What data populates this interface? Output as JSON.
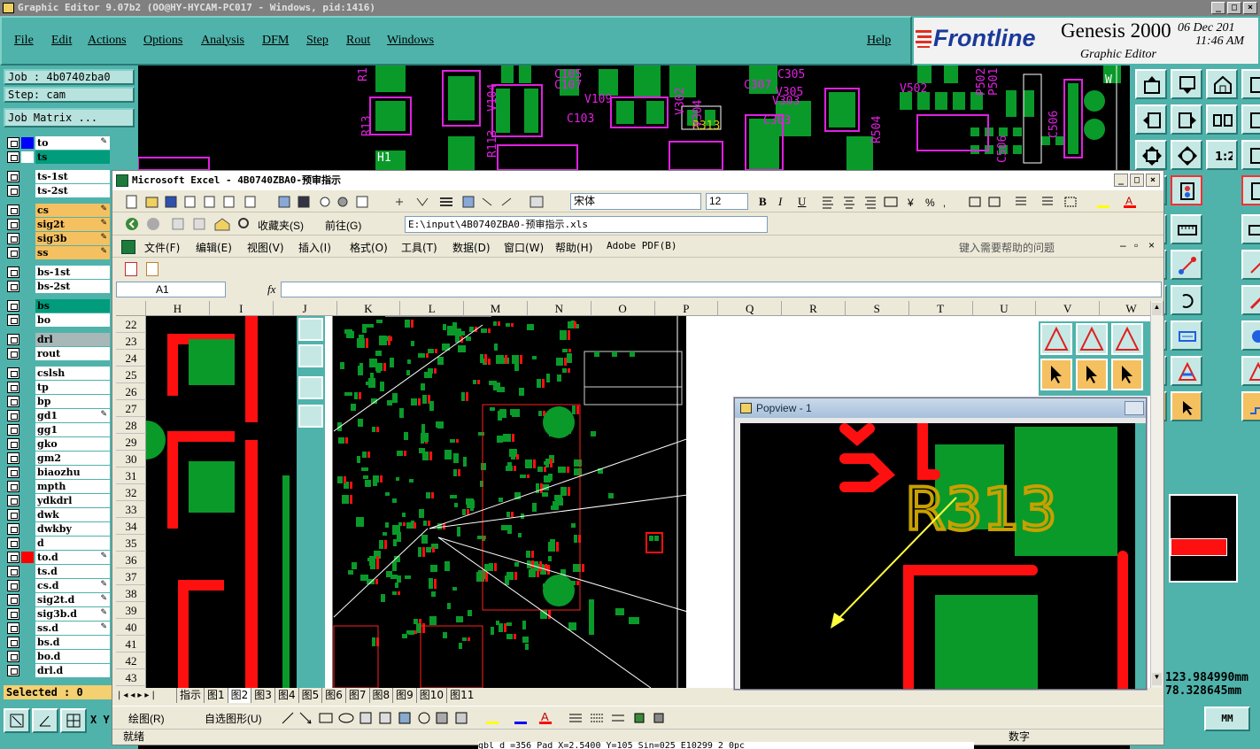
{
  "genesis": {
    "title": "Graphic Editor 9.07b2 (OO@HY-HYCAM-PC017 - Windows, pid:1416)",
    "menu": [
      "File",
      "Edit",
      "Actions",
      "Options",
      "Analysis",
      "DFM",
      "Step",
      "Rout",
      "Windows"
    ],
    "help": "Help",
    "brand": "Frontline",
    "product": "Genesis 2000",
    "subtitle": "Graphic Editor",
    "date": "06 Dec 201",
    "time": "11:46 AM",
    "job": "Job : 4b0740zba0",
    "step": "Step: cam",
    "job_matrix": "Job Matrix ...",
    "selected": "Selected : 0",
    "coord_x": "123.984990mm",
    "coord_y": "78.328645mm",
    "units": "MM",
    "xy": "X Y",
    "bottom_text": "gbl d =356 Pad X=2.5400 Y=105 Sin=025 E10299 2 0pc",
    "layers": [
      {
        "name": "to",
        "color": "#ffffff",
        "ind": "#0000ff",
        "edit": "✎"
      },
      {
        "name": "ts",
        "color": "#009c7c",
        "ind": "#ffffff",
        "edit": ""
      },
      {
        "name": "ts-1st",
        "color": "#ffffff",
        "ind": "",
        "edit": ""
      },
      {
        "name": "ts-2st",
        "color": "#ffffff",
        "ind": "",
        "edit": ""
      },
      {
        "name": "cs",
        "color": "#f5c060",
        "ind": "",
        "edit": "✎"
      },
      {
        "name": "sig2t",
        "color": "#f5c060",
        "ind": "",
        "edit": "✎"
      },
      {
        "name": "sig3b",
        "color": "#f5c060",
        "ind": "",
        "edit": "✎"
      },
      {
        "name": "ss",
        "color": "#f5c060",
        "ind": "",
        "edit": "✎"
      },
      {
        "name": "bs-1st",
        "color": "#ffffff",
        "ind": "",
        "edit": ""
      },
      {
        "name": "bs-2st",
        "color": "#ffffff",
        "ind": "",
        "edit": ""
      },
      {
        "name": "bs",
        "color": "#009c7c",
        "ind": "",
        "edit": ""
      },
      {
        "name": "bo",
        "color": "#ffffff",
        "ind": "",
        "edit": ""
      },
      {
        "name": "drl",
        "color": "#a8b8b8",
        "ind": "",
        "edit": ""
      },
      {
        "name": "rout",
        "color": "#ffffff",
        "ind": "",
        "edit": ""
      },
      {
        "name": "cslsh",
        "color": "#ffffff",
        "ind": "",
        "edit": ""
      },
      {
        "name": "tp",
        "color": "#ffffff",
        "ind": "",
        "edit": ""
      },
      {
        "name": "bp",
        "color": "#ffffff",
        "ind": "",
        "edit": ""
      },
      {
        "name": "gd1",
        "color": "#ffffff",
        "ind": "",
        "edit": "✎"
      },
      {
        "name": "gg1",
        "color": "#ffffff",
        "ind": "",
        "edit": ""
      },
      {
        "name": "gko",
        "color": "#ffffff",
        "ind": "",
        "edit": ""
      },
      {
        "name": "gm2",
        "color": "#ffffff",
        "ind": "",
        "edit": ""
      },
      {
        "name": "biaozhu",
        "color": "#ffffff",
        "ind": "",
        "edit": ""
      },
      {
        "name": "mpth",
        "color": "#ffffff",
        "ind": "",
        "edit": ""
      },
      {
        "name": "ydkdrl",
        "color": "#ffffff",
        "ind": "",
        "edit": ""
      },
      {
        "name": "dwk",
        "color": "#ffffff",
        "ind": "",
        "edit": ""
      },
      {
        "name": "dwkby",
        "color": "#ffffff",
        "ind": "",
        "edit": ""
      },
      {
        "name": "d",
        "color": "#ffffff",
        "ind": "",
        "edit": ""
      },
      {
        "name": "to.d",
        "color": "#ffffff",
        "ind": "#ff0000",
        "edit": "✎"
      },
      {
        "name": "ts.d",
        "color": "#ffffff",
        "ind": "",
        "edit": ""
      },
      {
        "name": "cs.d",
        "color": "#ffffff",
        "ind": "",
        "edit": "✎"
      },
      {
        "name": "sig2t.d",
        "color": "#ffffff",
        "ind": "",
        "edit": "✎"
      },
      {
        "name": "sig3b.d",
        "color": "#ffffff",
        "ind": "",
        "edit": "✎"
      },
      {
        "name": "ss.d",
        "color": "#ffffff",
        "ind": "",
        "edit": "✎"
      },
      {
        "name": "bs.d",
        "color": "#ffffff",
        "ind": "",
        "edit": ""
      },
      {
        "name": "bo.d",
        "color": "#ffffff",
        "ind": "",
        "edit": ""
      },
      {
        "name": "drl.d",
        "color": "#ffffff",
        "ind": "",
        "edit": ""
      }
    ],
    "canvas_labels": [
      "R1",
      "C105",
      "C107",
      "V109",
      "C103",
      "C305",
      "C307",
      "V305",
      "V303",
      "R313",
      "R13",
      "R113",
      "V104",
      "V302",
      "V304",
      "C303",
      "R504",
      "C506",
      "P502",
      "P501",
      "V502",
      "H1",
      "C506",
      "W"
    ]
  },
  "excel": {
    "title": "Microsoft Excel - 4B0740ZBA0-预审指示",
    "font_name": "宋体",
    "font_size": "12",
    "favorites": "收藏夹(S)",
    "goto": "前往(G)",
    "path": "E:\\input\\4B0740ZBA0-预审指示.xls",
    "menus": [
      "文件(F)",
      "编辑(E)",
      "视图(V)",
      "插入(I)",
      "格式(O)",
      "工具(T)",
      "数据(D)",
      "窗口(W)",
      "帮助(H)",
      "Adobe PDF(B)"
    ],
    "help_placeholder": "键入需要帮助的问题",
    "cell_ref": "A1",
    "fx": "fx",
    "columns": [
      "H",
      "I",
      "J",
      "K",
      "L",
      "M",
      "N",
      "O",
      "P",
      "Q",
      "R",
      "S",
      "T",
      "U",
      "V",
      "W"
    ],
    "rows": [
      "22",
      "23",
      "24",
      "25",
      "26",
      "27",
      "28",
      "29",
      "30",
      "31",
      "32",
      "33",
      "34",
      "35",
      "36",
      "37",
      "38",
      "39",
      "40",
      "41",
      "42",
      "43"
    ],
    "sheet_tabs": [
      "指示",
      "图1",
      "图2",
      "图3",
      "图4",
      "图5",
      "图6",
      "图7",
      "图8",
      "图9",
      "图10",
      "图11"
    ],
    "active_tab": "图2",
    "draw_label": "绘图(R)",
    "autoshape_label": "自选图形(U)",
    "status_ready": "就绪",
    "status_num": "数字"
  },
  "popview": {
    "title": "Popview - 1",
    "label": "R313"
  }
}
